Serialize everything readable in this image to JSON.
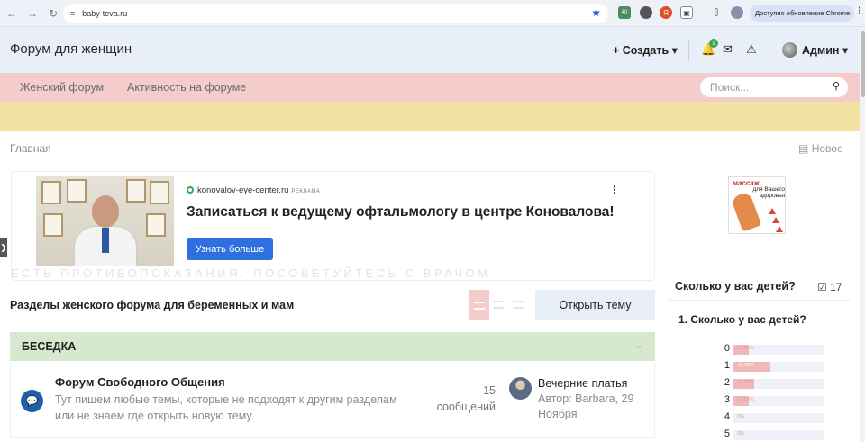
{
  "browser": {
    "url": "baby-teva.ru",
    "update_label": "Доступно обновление Chrome",
    "ext_badge": "40"
  },
  "header": {
    "site_title": "Форум для женщин",
    "create_label": "+ Создать",
    "user_label": "Админ",
    "notification_count": "1"
  },
  "nav": {
    "links": [
      "Женский форум",
      "Активность на форуме"
    ],
    "search_placeholder": "Поиск..."
  },
  "breadcrumb": {
    "home": "Главная",
    "new_label": "Новое"
  },
  "ad": {
    "domain": "konovalov-eye-center.ru",
    "tag": "РЕКЛАМА",
    "headline": "Записаться к ведущему офтальмологу в центре Коновалова!",
    "button": "Узнать больше",
    "disclaimer": "ЕСТЬ ПРОТИВОПОКАЗАНИЯ. ПОСОВЕТУЙТЕСЬ С ВРАЧОМ"
  },
  "section": {
    "title": "Разделы женского форума для беременных и мам",
    "open_topic": "Открыть тему"
  },
  "category": {
    "title": "БЕСЕДКА",
    "forums": [
      {
        "name": "Форум Свободного Общения",
        "description": "Тут пишем любые темы, которые не подходят к другим разделам или не знаем где открыть новую тему.",
        "count": "15",
        "count_label": "сообщений",
        "last_title": "Вечерние платья",
        "last_author": "Автор: Barbara, 29 Ноября"
      }
    ]
  },
  "sidebar": {
    "ad_word": "массаж",
    "ad_sub": "для Вашего здоровья",
    "poll": {
      "title": "Сколько у вас детей?",
      "votes": "17",
      "question": "1. Сколько у вас детей?",
      "options": [
        {
          "label": "0",
          "pct": "17,65%",
          "value": 17.65
        },
        {
          "label": "1",
          "pct": "41,18%",
          "value": 41.18
        },
        {
          "label": "2",
          "pct": "23,53%",
          "value": 23.53
        },
        {
          "label": "3",
          "pct": "17,65%",
          "value": 17.65
        },
        {
          "label": "4",
          "pct": "0%",
          "value": 0
        },
        {
          "label": "5",
          "pct": "0%",
          "value": 0
        }
      ]
    }
  },
  "colors": {
    "header_bg": "#e8eff8",
    "nav_bg": "#f4cccc",
    "strip_bg": "#f3e3a2",
    "category_bg": "#d6e9cf",
    "accent_blue": "#2f6fe0"
  }
}
